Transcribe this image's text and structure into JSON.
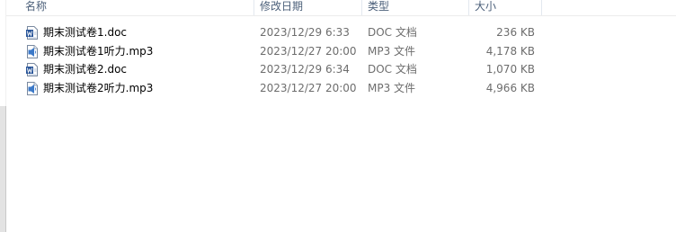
{
  "columns": {
    "name": "名称",
    "date": "修改日期",
    "type": "类型",
    "size": "大小"
  },
  "files": [
    {
      "icon": "word-doc-icon",
      "name": "期末测试卷1.doc",
      "date": "2023/12/29 6:33",
      "type": "DOC 文档",
      "size": "236 KB"
    },
    {
      "icon": "mp3-audio-icon",
      "name": "期末测试卷1听力.mp3",
      "date": "2023/12/27 20:00",
      "type": "MP3 文件",
      "size": "4,178 KB"
    },
    {
      "icon": "word-doc-icon",
      "name": "期末测试卷2.doc",
      "date": "2023/12/29 6:34",
      "type": "DOC 文档",
      "size": "1,070 KB"
    },
    {
      "icon": "mp3-audio-icon",
      "name": "期末测试卷2听力.mp3",
      "date": "2023/12/27 20:00",
      "type": "MP3 文件",
      "size": "4,966 KB"
    }
  ],
  "colors": {
    "header_text": "#4c607a",
    "meta_text": "#6d6d6d",
    "doc_icon_blue": "#2b579a",
    "mp3_icon_blue": "#3c79c8"
  }
}
